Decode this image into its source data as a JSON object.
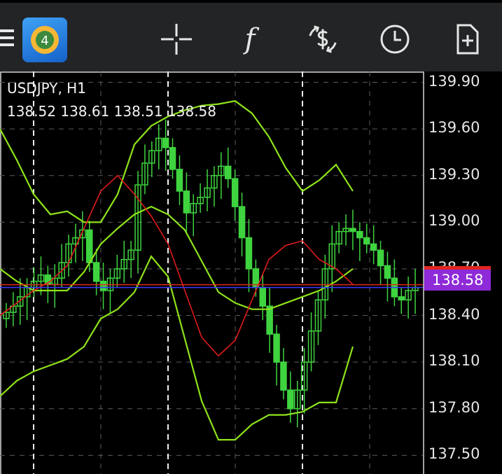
{
  "toolbar": {
    "icons": [
      "menu-icon",
      "app-logo-icon",
      "crosshair-icon",
      "indicators-icon",
      "trade-icon",
      "timeframe-icon",
      "new-object-icon"
    ],
    "indicator_glyph": "f"
  },
  "chart_header": {
    "symbol": "USDJPY, H1",
    "ohlc": "138.52 138.61 138.51 138.58"
  },
  "price_axis": {
    "ticks": [
      "139.90",
      "139.60",
      "139.30",
      "139.00",
      "138.70",
      "138.40",
      "138.10",
      "137.80",
      "137.50"
    ],
    "current_price": "138.58"
  },
  "colors": {
    "background": "#000000",
    "toolbar": "#222426",
    "candle": "#3fd43f",
    "band": "#8ee21a",
    "ma": "#e01b1b",
    "bid_line": "#3a3aff",
    "ask_line": "#e0261f",
    "price_badge": "#8e2ad8"
  },
  "chart_data": {
    "type": "line",
    "ylim": [
      137.38,
      139.97
    ],
    "candles_close": [
      138.42,
      138.46,
      138.52,
      138.58,
      138.62,
      138.66,
      138.6,
      138.64,
      138.74,
      138.86,
      138.9,
      138.95,
      138.74,
      138.62,
      138.56,
      138.64,
      138.7,
      138.76,
      138.82,
      139.24,
      139.38,
      139.46,
      139.54,
      139.48,
      139.34,
      139.2,
      139.06,
      139.12,
      139.16,
      139.22,
      139.3,
      139.36,
      139.28,
      139.1,
      138.9,
      138.7,
      138.58,
      138.46,
      138.28,
      138.1,
      137.92,
      137.8,
      137.92,
      138.1,
      138.3,
      138.5,
      138.7,
      138.86,
      138.94,
      138.96,
      138.94,
      138.9,
      138.86,
      138.82,
      138.72,
      138.64,
      138.52,
      138.5,
      138.56,
      138.58
    ],
    "series": [
      {
        "values": [
          139.6,
          139.4,
          139.18,
          139.05,
          139.07,
          139.0,
          139.0,
          139.18,
          139.5,
          139.62,
          139.68,
          139.72,
          139.75,
          139.76,
          139.78,
          139.7,
          139.55,
          139.35,
          139.2,
          139.27,
          139.37,
          139.2
        ]
      },
      {
        "values": [
          138.7,
          138.62,
          138.56,
          138.56,
          138.56,
          138.68,
          138.86,
          138.96,
          139.05,
          139.1,
          139.05,
          138.95,
          138.75,
          138.55,
          138.48,
          138.44,
          138.44,
          138.48,
          138.52,
          138.56,
          138.62,
          138.7
        ]
      },
      {
        "values": [
          137.88,
          137.98,
          138.04,
          138.08,
          138.12,
          138.2,
          138.38,
          138.44,
          138.55,
          138.78,
          138.65,
          138.25,
          137.85,
          137.6,
          137.6,
          137.7,
          137.76,
          137.76,
          137.78,
          137.84,
          137.84,
          138.2
        ]
      },
      {
        "values": [
          138.4,
          138.48,
          138.56,
          138.62,
          138.72,
          138.96,
          139.2,
          139.3,
          139.18,
          139.04,
          138.86,
          138.56,
          138.26,
          138.14,
          138.24,
          138.5,
          138.76,
          138.85,
          138.88,
          138.76,
          138.7,
          138.6
        ]
      }
    ],
    "grid": true
  }
}
